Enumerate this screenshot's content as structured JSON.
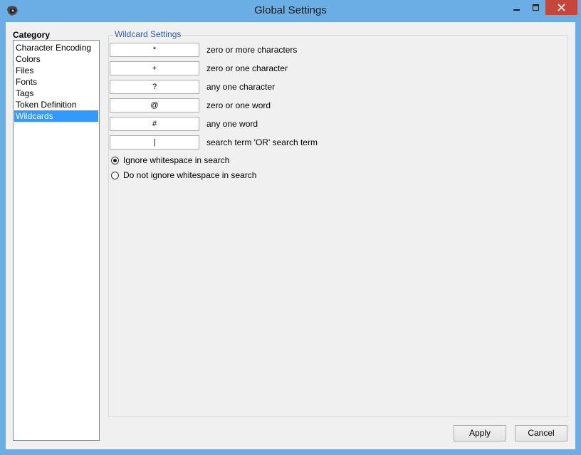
{
  "window": {
    "title": "Global Settings"
  },
  "sidebar": {
    "heading": "Category",
    "items": [
      "Character Encoding",
      "Colors",
      "Files",
      "Fonts",
      "Tags",
      "Token Definition",
      "Wildcards"
    ],
    "selected": "Wildcards"
  },
  "wildcards": {
    "legend": "Wildcard Settings",
    "rows": [
      {
        "symbol": "*",
        "label": "zero or more characters"
      },
      {
        "symbol": "+",
        "label": "zero or one character"
      },
      {
        "symbol": "?",
        "label": "any one character"
      },
      {
        "symbol": "@",
        "label": "zero or one word"
      },
      {
        "symbol": "#",
        "label": "any one word"
      },
      {
        "symbol": "|",
        "label": "search term 'OR' search term"
      }
    ],
    "whitespace_options": [
      {
        "label": "Ignore whitespace in search",
        "checked": true
      },
      {
        "label": "Do not ignore whitespace in search",
        "checked": false
      }
    ]
  },
  "buttons": {
    "apply": "Apply",
    "cancel": "Cancel"
  },
  "colors": {
    "titlebar": "#6aaee5",
    "selection": "#3399ff",
    "legend": "#2a5ab8",
    "close": "#c7463c"
  }
}
